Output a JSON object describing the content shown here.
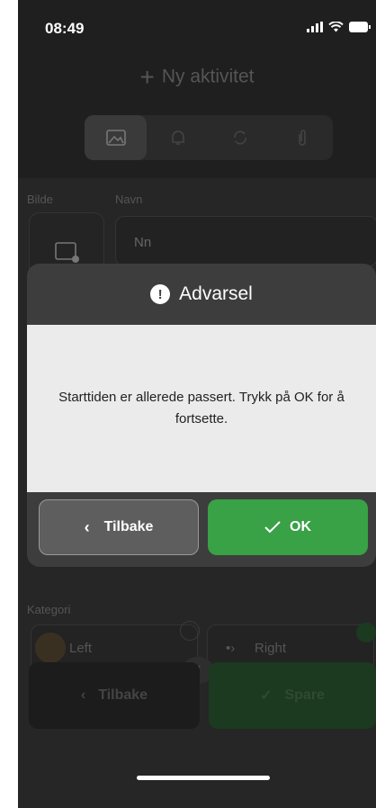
{
  "status_bar": {
    "time": "08:49"
  },
  "header": {
    "title": "Ny aktivitet"
  },
  "form": {
    "image_label": "Bilde",
    "name_label": "Navn",
    "name_value": "Nn",
    "category_label": "Kategori",
    "category_left": "Left",
    "category_right": "Right",
    "back_label": "Tilbake",
    "save_label": "Spare"
  },
  "dialog": {
    "title": "Advarsel",
    "message": "Starttiden er allerede passert. Trykk på OK for å fortsette.",
    "back_label": "Tilbake",
    "ok_label": "OK"
  },
  "colors": {
    "ok_green": "#39a146",
    "dialog_bg": "#3d3d3d",
    "body_bg": "#ebebeb"
  }
}
